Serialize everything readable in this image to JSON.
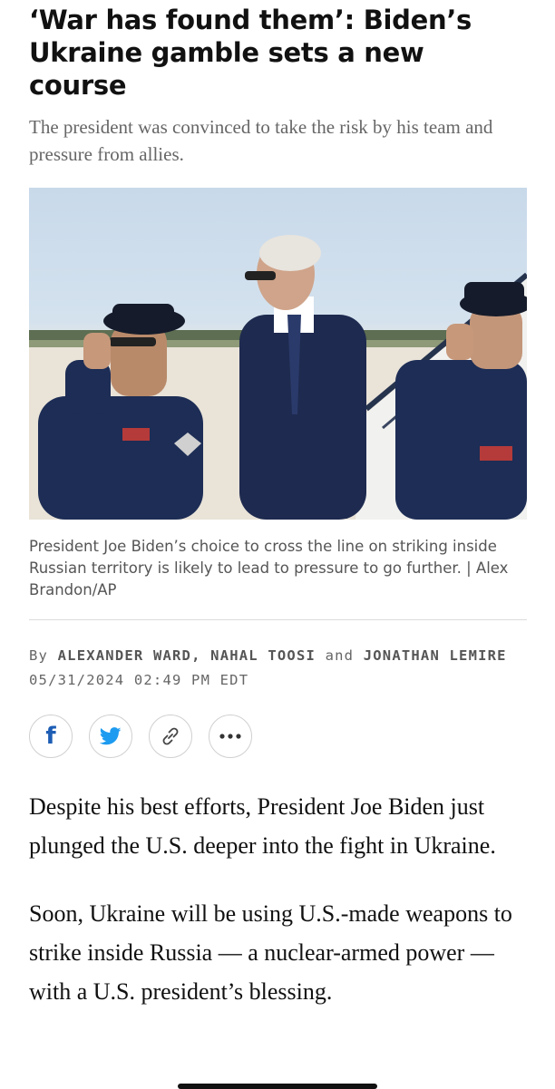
{
  "article": {
    "headline": "‘War has found them’: Biden’s Ukraine gamble sets a new course",
    "dek": "The president was convinced to take the risk by his team and pressure from allies.",
    "image_alt": "Biden walking between two saluting Air Force service members near Air Force One",
    "caption": "President Joe Biden’s choice to cross the line on striking inside Russian territory is likely to lead to pressure to go further. | Alex Brandon/AP",
    "byline": {
      "prefix": "By",
      "author1": "ALEXANDER WARD,",
      "author2": "NAHAL TOOSI",
      "conj": "and",
      "author3": "JONATHAN LEMIRE"
    },
    "date": "05/31/2024 02:49 PM EDT",
    "paragraphs": [
      "Despite his best efforts, President Joe Biden just plunged the U.S. deeper into the fight in Ukraine.",
      "Soon, Ukraine will be using U.S.-made weapons to strike inside Russia — a nuclear-armed power — with a U.S. president’s blessing."
    ]
  },
  "share": {
    "facebook_label": "f",
    "buttons": [
      "facebook-icon",
      "twitter-icon",
      "link-icon",
      "more-icon"
    ],
    "facebook_color": "#1d5db4",
    "twitter_color": "#1d9bf0"
  }
}
